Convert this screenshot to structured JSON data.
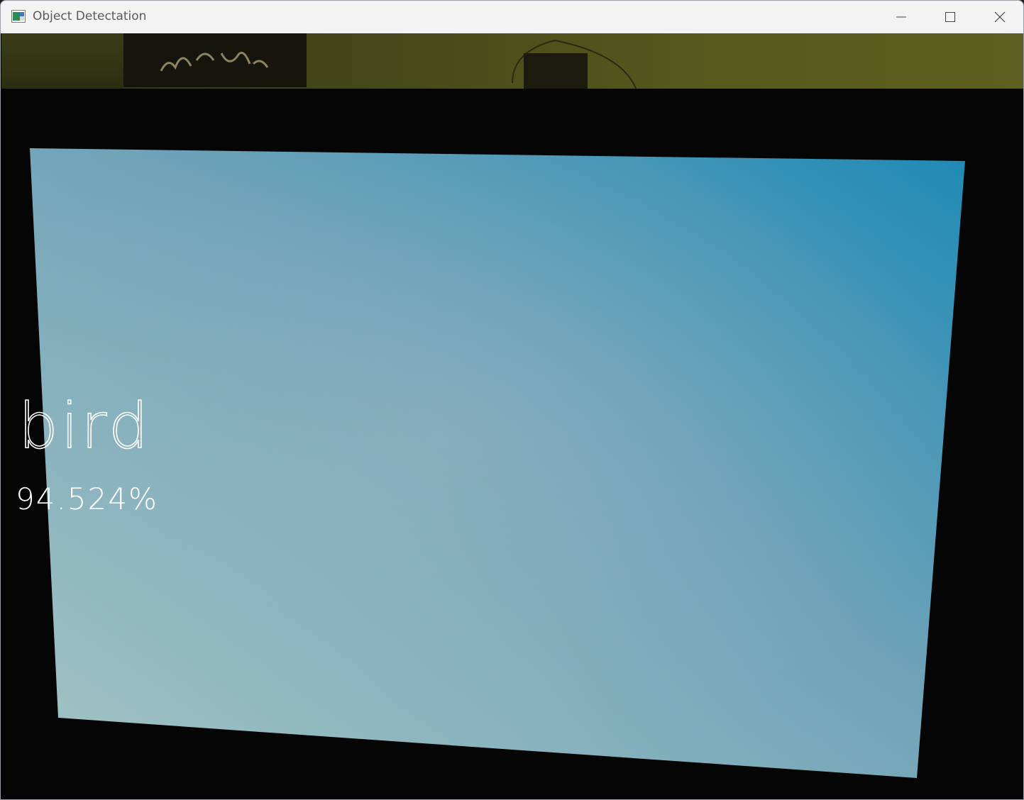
{
  "window": {
    "title": "Object Detectation",
    "controls": {
      "minimize_icon": "minimize-icon",
      "maximize_icon": "maximize-icon",
      "close_icon": "close-icon"
    }
  },
  "detection": {
    "label": "bird",
    "confidence": "94.524%",
    "label_color": "#ffffff"
  },
  "colors": {
    "titlebar": "#f3f3f3",
    "title_text": "#5a5a5a",
    "screen_top_right": "#1f8ab5",
    "screen_bottom_left": "#9fbfc2"
  }
}
